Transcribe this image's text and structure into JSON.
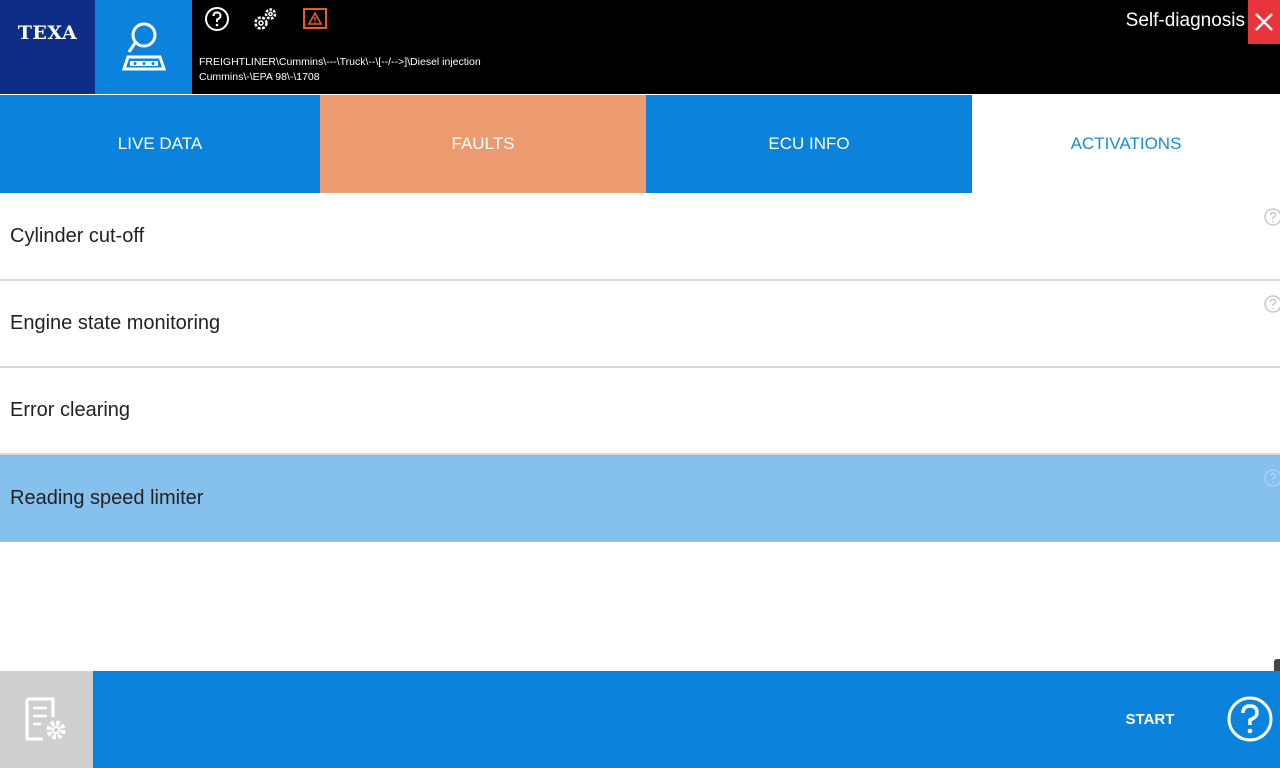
{
  "header": {
    "logo": "TEXA",
    "title": "Self-diagnosis",
    "breadcrumb_line1": "FREIGHTLINER\\Cummins\\---\\Truck\\--\\[--/-->]\\Diesel injection",
    "breadcrumb_line2": "Cummins\\-\\EPA 98\\-\\1708",
    "icons": [
      "diagnosis-icon",
      "help-icon",
      "gears-icon",
      "warning-icon",
      "close-icon"
    ]
  },
  "tabs": [
    {
      "label": "LIVE DATA",
      "state": "default"
    },
    {
      "label": "FAULTS",
      "state": "highlighted"
    },
    {
      "label": "ECU INFO",
      "state": "default"
    },
    {
      "label": "ACTIVATIONS",
      "state": "active"
    }
  ],
  "activations": [
    {
      "label": "Cylinder cut-off",
      "selected": false
    },
    {
      "label": "Engine state monitoring",
      "selected": false
    },
    {
      "label": "Error clearing",
      "selected": false
    },
    {
      "label": "Reading speed limiter",
      "selected": true
    }
  ],
  "footer": {
    "start_label": "START",
    "icons": [
      "settings-document-icon",
      "help-circle-icon"
    ]
  },
  "colors": {
    "brand_dark": "#0d2d86",
    "accent_blue": "#0b82dc",
    "faults_orange": "#ec9b71",
    "selected_row": "#86c1ee",
    "close_red": "#e8333a"
  }
}
